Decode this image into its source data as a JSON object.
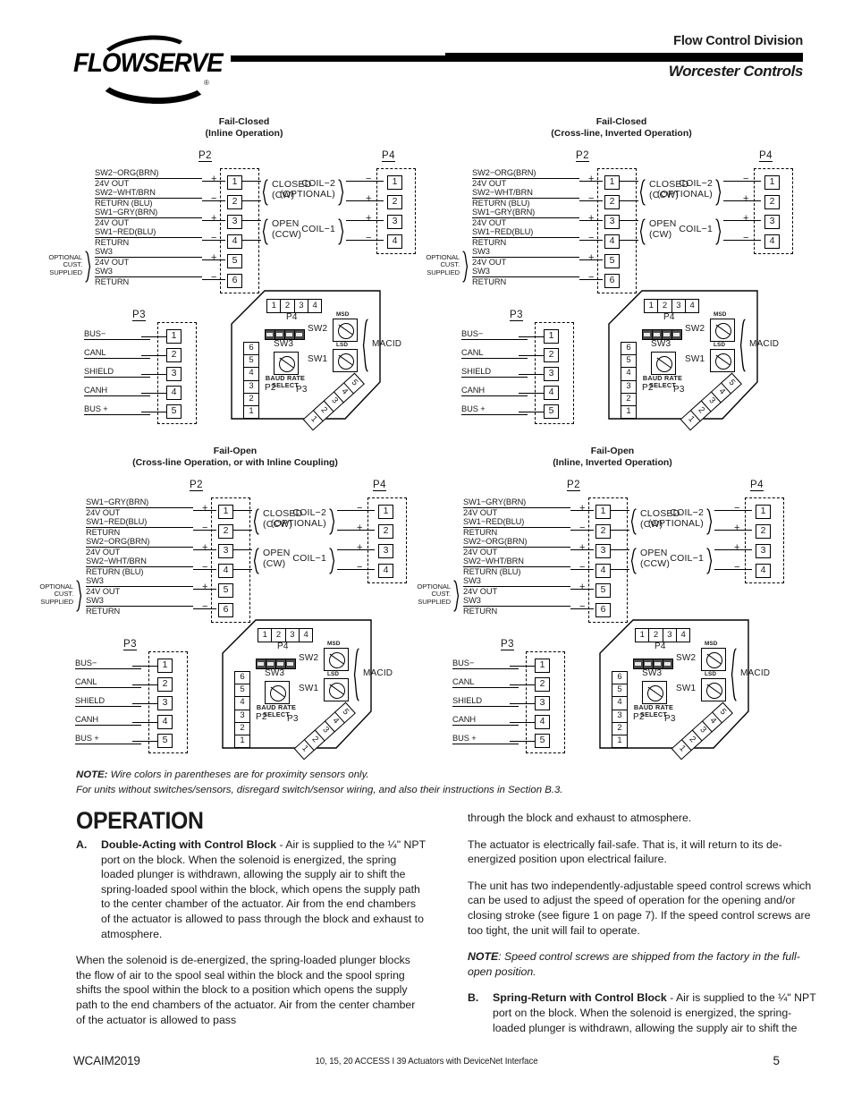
{
  "header": {
    "logo_text": "FLOWSERVE",
    "registered_mark": "®",
    "division": "Flow Control Division",
    "brand": "Worcester Controls"
  },
  "diagrams": [
    {
      "id": "fail-closed-inline",
      "title_line1": "Fail-Closed",
      "title_line2": "(Inline Operation)",
      "p2_label": "P2",
      "p4_label": "P4",
      "p3_label": "P3",
      "p2_rows": [
        {
          "pin": "1",
          "line1": "SW2−ORG(BRN)",
          "line2": "24V  OUT",
          "sign": "+"
        },
        {
          "pin": "2",
          "line1": "SW2−WHT/BRN",
          "line2": "RETURN  (BLU)",
          "sign": "−"
        },
        {
          "pin": "3",
          "line1": "SW1−GRY(BRN)",
          "line2": "24V  OUT",
          "sign": "+"
        },
        {
          "pin": "4",
          "line1": "SW1−RED(BLU)",
          "line2": "RETURN",
          "sign": "−"
        },
        {
          "pin": "5",
          "line1": "SW3",
          "line2": "24V  OUT",
          "sign": "+"
        },
        {
          "pin": "6",
          "line1": "SW3",
          "line2": "RETURN",
          "sign": "−"
        }
      ],
      "p2_groups": [
        {
          "line1": "CLOSED",
          "line2": "(CW)"
        },
        {
          "line1": "OPEN",
          "line2": "(CCW)"
        }
      ],
      "optional_note": [
        "OPTIONAL",
        "CUST.",
        "SUPPLIED"
      ],
      "p4_rows": [
        {
          "pin": "1",
          "sign": "−"
        },
        {
          "pin": "2",
          "sign": "+"
        },
        {
          "pin": "3",
          "sign": "+"
        },
        {
          "pin": "4",
          "sign": "−"
        }
      ],
      "p4_groups": [
        {
          "line1": "COIL−2",
          "line2": "(OPTIONAL)"
        },
        {
          "line1": "COIL−1",
          "line2": ""
        }
      ],
      "p3_rows": [
        {
          "pin": "1",
          "label": "BUS−"
        },
        {
          "pin": "2",
          "label": "CANL"
        },
        {
          "pin": "3",
          "label": "SHIELD"
        },
        {
          "pin": "4",
          "label": "CANH"
        },
        {
          "pin": "5",
          "label": "BUS  +"
        }
      ]
    },
    {
      "id": "fail-closed-crossline-inverted",
      "title_line1": "Fail-Closed",
      "title_line2": "(Cross-line, Inverted Operation)",
      "p2_label": "P2",
      "p4_label": "P4",
      "p3_label": "P3",
      "p2_rows": [
        {
          "pin": "1",
          "line1": "SW2−ORG(BRN)",
          "line2": "24V  OUT",
          "sign": "+"
        },
        {
          "pin": "2",
          "line1": "SW2−WHT/BRN",
          "line2": "RETURN  (BLU)",
          "sign": "−"
        },
        {
          "pin": "3",
          "line1": "SW1−GRY(BRN)",
          "line2": "24V  OUT",
          "sign": "+"
        },
        {
          "pin": "4",
          "line1": "SW1−RED(BLU)",
          "line2": "RETURN",
          "sign": "−"
        },
        {
          "pin": "5",
          "line1": "SW3",
          "line2": "24V  OUT",
          "sign": "+"
        },
        {
          "pin": "6",
          "line1": "SW3",
          "line2": "RETURN",
          "sign": "−"
        }
      ],
      "p2_groups": [
        {
          "line1": "CLOSED",
          "line2": "(CCW)"
        },
        {
          "line1": "OPEN",
          "line2": "(CW)"
        }
      ],
      "optional_note": [
        "OPTIONAL",
        "CUST.",
        "SUPPLIED"
      ],
      "p4_rows": [
        {
          "pin": "1",
          "sign": "−"
        },
        {
          "pin": "2",
          "sign": "+"
        },
        {
          "pin": "3",
          "sign": "+"
        },
        {
          "pin": "4",
          "sign": "−"
        }
      ],
      "p4_groups": [
        {
          "line1": "COIL−2",
          "line2": "(OPTIONAL)"
        },
        {
          "line1": "COIL−1",
          "line2": ""
        }
      ],
      "p3_rows": [
        {
          "pin": "1",
          "label": "BUS−"
        },
        {
          "pin": "2",
          "label": "CANL"
        },
        {
          "pin": "3",
          "label": "SHIELD"
        },
        {
          "pin": "4",
          "label": "CANH"
        },
        {
          "pin": "5",
          "label": "BUS  +"
        }
      ]
    },
    {
      "id": "fail-open-crossline",
      "title_line1": "Fail-Open",
      "title_line2": "(Cross-line Operation, or with Inline Coupling)",
      "p2_label": "P2",
      "p4_label": "P4",
      "p3_label": "P3",
      "p2_rows": [
        {
          "pin": "1",
          "line1": "SW1−GRY(BRN)",
          "line2": "24V  OUT",
          "sign": "+"
        },
        {
          "pin": "2",
          "line1": "SW1−RED(BLU)",
          "line2": "RETURN",
          "sign": "−"
        },
        {
          "pin": "3",
          "line1": "SW2−ORG(BRN)",
          "line2": "24V  OUT",
          "sign": "+"
        },
        {
          "pin": "4",
          "line1": "SW2−WHT/BRN",
          "line2": "RETURN  (BLU)",
          "sign": "−"
        },
        {
          "pin": "5",
          "line1": "SW3",
          "line2": "24V  OUT",
          "sign": "+"
        },
        {
          "pin": "6",
          "line1": "SW3",
          "line2": "RETURN",
          "sign": "−"
        }
      ],
      "p2_groups": [
        {
          "line1": "CLOSED",
          "line2": "(CCW)"
        },
        {
          "line1": "OPEN",
          "line2": "(CW)"
        }
      ],
      "optional_note": [
        "OPTIONAL",
        "CUST.",
        "SUPPLIED"
      ],
      "p4_rows": [
        {
          "pin": "1",
          "sign": "−"
        },
        {
          "pin": "2",
          "sign": "+"
        },
        {
          "pin": "3",
          "sign": "+"
        },
        {
          "pin": "4",
          "sign": "−"
        }
      ],
      "p4_groups": [
        {
          "line1": "COIL−2",
          "line2": "(OPTIONAL)"
        },
        {
          "line1": "COIL−1",
          "line2": ""
        }
      ],
      "p3_rows": [
        {
          "pin": "1",
          "label": "BUS−"
        },
        {
          "pin": "2",
          "label": "CANL"
        },
        {
          "pin": "3",
          "label": "SHIELD"
        },
        {
          "pin": "4",
          "label": "CANH"
        },
        {
          "pin": "5",
          "label": "BUS  +"
        }
      ]
    },
    {
      "id": "fail-open-inline-inverted",
      "title_line1": "Fail-Open",
      "title_line2": "(Inline, Inverted Operation)",
      "p2_label": "P2",
      "p4_label": "P4",
      "p3_label": "P3",
      "p2_rows": [
        {
          "pin": "1",
          "line1": "SW1−GRY(BRN)",
          "line2": "24V  OUT",
          "sign": "+"
        },
        {
          "pin": "2",
          "line1": "SW1−RED(BLU)",
          "line2": "RETURN",
          "sign": "−"
        },
        {
          "pin": "3",
          "line1": "SW2−ORG(BRN)",
          "line2": "24V  OUT",
          "sign": "+"
        },
        {
          "pin": "4",
          "line1": "SW2−WHT/BRN",
          "line2": "RETURN  (BLU)",
          "sign": "−"
        },
        {
          "pin": "5",
          "line1": "SW3",
          "line2": "24V  OUT",
          "sign": "+"
        },
        {
          "pin": "6",
          "line1": "SW3",
          "line2": "RETURN",
          "sign": "−"
        }
      ],
      "p2_groups": [
        {
          "line1": "CLOSED",
          "line2": "(CW)"
        },
        {
          "line1": "OPEN",
          "line2": "(CCW)"
        }
      ],
      "optional_note": [
        "OPTIONAL",
        "CUST.",
        "SUPPLIED"
      ],
      "p4_rows": [
        {
          "pin": "1",
          "sign": "−"
        },
        {
          "pin": "2",
          "sign": "+"
        },
        {
          "pin": "3",
          "sign": "+"
        },
        {
          "pin": "4",
          "sign": "−"
        }
      ],
      "p4_groups": [
        {
          "line1": "COIL−2",
          "line2": "(OPTIONAL)"
        },
        {
          "line1": "COIL−1",
          "line2": ""
        }
      ],
      "p3_rows": [
        {
          "pin": "1",
          "label": "BUS−"
        },
        {
          "pin": "2",
          "label": "CANL"
        },
        {
          "pin": "3",
          "label": "SHIELD"
        },
        {
          "pin": "4",
          "label": "CANH"
        },
        {
          "pin": "5",
          "label": "BUS  +"
        }
      ]
    }
  ],
  "board": {
    "p4_label": "P4",
    "p4_pins": [
      "1",
      "2",
      "3",
      "4"
    ],
    "p2_label": "P2",
    "p2_pins": [
      "6",
      "5",
      "4",
      "3",
      "2",
      "1"
    ],
    "p3_label": "P3",
    "p3_pins": [
      "1",
      "2",
      "3",
      "4",
      "5"
    ],
    "sw1_label": "SW1",
    "sw1_sub": "LSD",
    "sw2_label": "SW2",
    "sw2_sub": "MSD",
    "sw3_label": "SW3",
    "sw3_sub_line1": "BAUD  RATE",
    "sw3_sub_line2": "SELECT",
    "macid_label": "MACID"
  },
  "note": {
    "prefix": "NOTE:",
    "line1": " Wire colors in parentheses are for proximity sensors only.",
    "line2": "For units without switches/sensors, disregard switch/sensor wiring, and also their instructions in Section B.3."
  },
  "operation": {
    "title": "OPERATION",
    "items": [
      {
        "marker": "A.",
        "heading": "Double-Acting with Control Block",
        "body": " - Air is supplied to the ¼\" NPT port on the block. When the solenoid is energized, the spring loaded plunger is withdrawn, allowing the supply air to shift the spring-loaded spool within the block, which opens the supply path to the center chamber of the actuator. Air from the end chambers of the actuator is allowed to pass through the block and exhaust to atmosphere."
      }
    ],
    "left_para2": "When the solenoid is de-energized, the spring-loaded plunger blocks the flow of air to the spool seal within the block and the spool spring shifts the spool within the block to a position which opens the supply path to the end chambers of the actuator. Air from the center chamber of the actuator is allowed to pass",
    "right_para1": "through the block and exhaust to atmosphere.",
    "right_para2": "The actuator is electrically fail-safe. That is, it will return to its de-energized position upon electrical failure.",
    "right_para3": "The unit has two independently-adjustable speed control screws which can be used to adjust the speed of operation for the opening and/or closing stroke (see figure 1 on page 7). If the speed control screws are too tight, the unit will fail to operate.",
    "right_note_prefix": "NOTE",
    "right_note_body": ": Speed control screws are shipped from the factory in the full-open position.",
    "right_item": {
      "marker": "B.",
      "heading": "Spring-Return with Control Block",
      "body": " - Air is supplied to the ¼\" NPT port on the block. When the solenoid is energized, the spring-loaded plunger is withdrawn, allowing the supply air to shift the"
    }
  },
  "footer": {
    "doc_id": "WCAIM2019",
    "center": "10, 15, 20 ACCESS I 39 Actuators with DeviceNet Interface",
    "page": "5"
  }
}
